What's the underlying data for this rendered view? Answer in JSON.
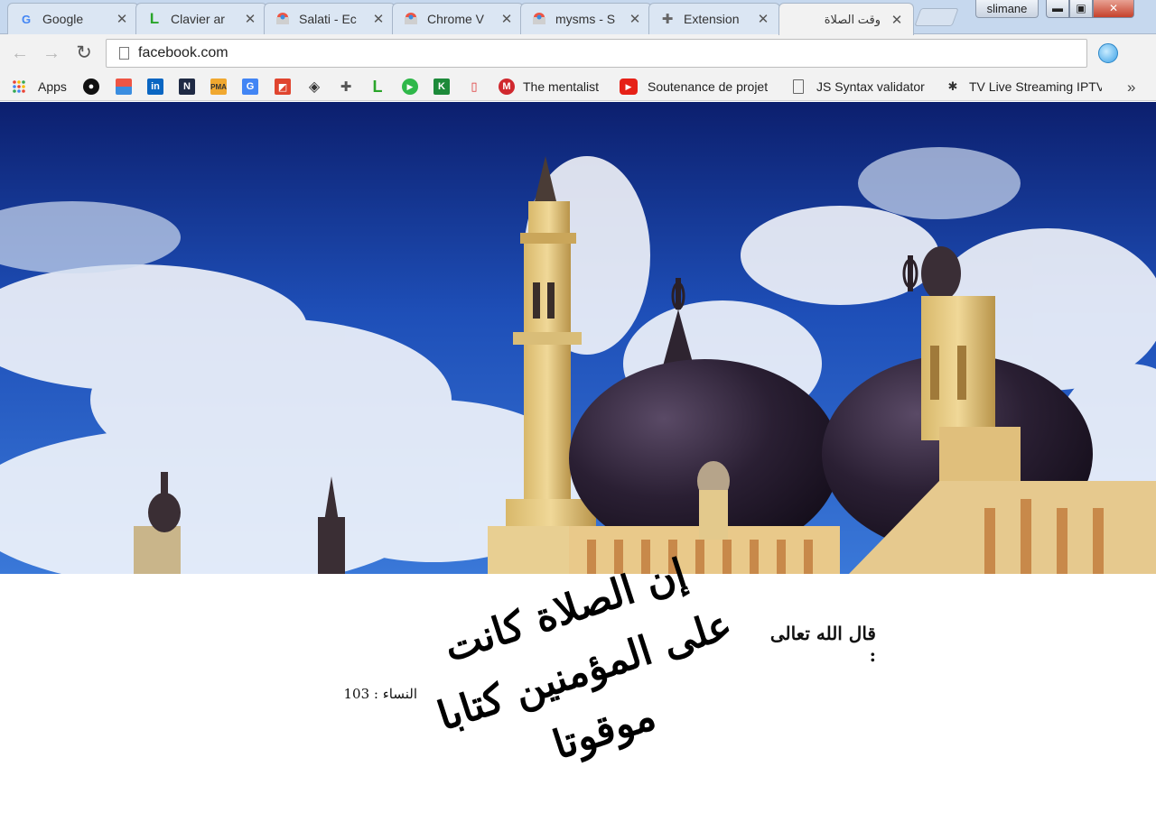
{
  "browser": {
    "tabs": [
      {
        "title": "Google",
        "icon": "google-icon",
        "active": false
      },
      {
        "title": "Clavier ar",
        "icon": "lexilogos-icon",
        "active": false
      },
      {
        "title": "Salati - Ec",
        "icon": "chrome-webstore-icon",
        "active": false
      },
      {
        "title": "Chrome V",
        "icon": "chrome-webstore-icon",
        "active": false
      },
      {
        "title": "mysms - S",
        "icon": "chrome-webstore-icon",
        "active": false
      },
      {
        "title": "Extension",
        "icon": "puzzle-icon",
        "active": false
      },
      {
        "title": "وقت الصلاة",
        "icon": "",
        "active": true
      }
    ],
    "close_glyph": "✕",
    "profile_name": "slimane",
    "window_controls": {
      "minimize": "▬",
      "maximize": "▣",
      "close": "✕"
    },
    "url": "facebook.com",
    "nav": {
      "back": "←",
      "forward": "→",
      "reload": "↻"
    }
  },
  "bookmarks": {
    "apps_label": "Apps",
    "items": [
      {
        "label": "",
        "icon": "github-icon"
      },
      {
        "label": "",
        "icon": "chrome-webstore-icon"
      },
      {
        "label": "",
        "icon": "linkedin-icon"
      },
      {
        "label": "",
        "icon": "n-logo-icon"
      },
      {
        "label": "",
        "icon": "pma-icon"
      },
      {
        "label": "",
        "icon": "google-translate-icon"
      },
      {
        "label": "",
        "icon": "red-app-icon"
      },
      {
        "label": "",
        "icon": "diamond-icon"
      },
      {
        "label": "",
        "icon": "puzzle-icon"
      },
      {
        "label": "",
        "icon": "lexilogos-icon"
      },
      {
        "label": "",
        "icon": "play-circle-icon"
      },
      {
        "label": "",
        "icon": "k-logo-icon"
      },
      {
        "label": "",
        "icon": "phone-icon"
      },
      {
        "label": "The mentalist",
        "icon": "m-red-icon"
      },
      {
        "label": "Soutenance de projet",
        "icon": "youtube-icon"
      },
      {
        "label": "JS Syntax validator",
        "icon": "page-icon"
      },
      {
        "label": "TV Live Streaming IPTV",
        "icon": "bug-icon"
      }
    ],
    "overflow": "»"
  },
  "page": {
    "verse_intro": "قال الله تعالى :",
    "verse_text": "إن الصلاة كانت على المؤمنين كتابا موقوتا",
    "verse_reference": "النساء : 103"
  }
}
